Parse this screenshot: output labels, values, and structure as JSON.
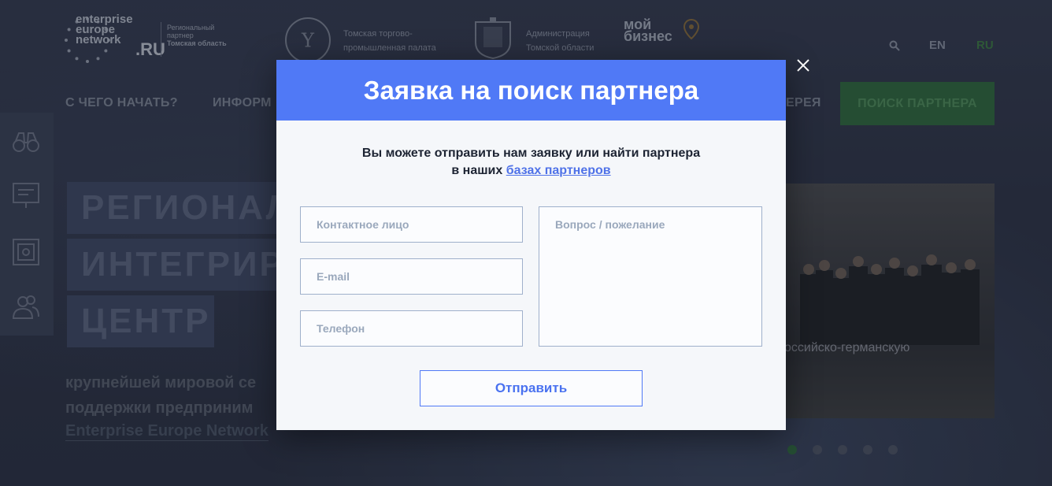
{
  "header": {
    "een_logo": {
      "brand": "enterprise europe network",
      "ru": ".RU",
      "partner_line1": "Региональный",
      "partner_line2": "партнер",
      "partner_line3": "Томская область"
    },
    "ttp_logo": {
      "text": "Томская торгово-промышленная палата"
    },
    "adm_logo": {
      "text": "Администрация Томской области"
    },
    "mb_logo": {
      "text1": "мой",
      "text2": "бизнес"
    },
    "search_icon": "search-icon",
    "lang_en": "EN",
    "lang_ru": "RU"
  },
  "nav": {
    "items": [
      "С ЧЕГО НАЧАТЬ?",
      "ИНФОРМ",
      "ЕРЕЯ"
    ],
    "cta": "ПОИСК ПАРТНЕРА"
  },
  "sidebar": {
    "icons": [
      "binoculars-icon",
      "presentation-icon",
      "safe-icon",
      "users-icon"
    ]
  },
  "hero": {
    "lines": [
      "РЕГИОНАЛ",
      "ИНТЕГРИР",
      "ЦЕНТР"
    ],
    "sub_line1": "крупнейшей мировой се",
    "sub_line2": "поддержки предприним",
    "link": "Enterprise Europe Network",
    "photo_caption": "оссийско-германскую",
    "slide_count": 5,
    "active_slide": 1
  },
  "modal": {
    "title": "Заявка на поиск партнера",
    "intro_line1": "Вы можете отправить нам заявку или найти партнера",
    "intro_prefix": "в наших ",
    "intro_link": "базах партнеров",
    "contact_placeholder": "Контактное лицо",
    "email_placeholder": "E-mail",
    "phone_placeholder": "Телефон",
    "question_placeholder": "Вопрос / пожелание",
    "submit_label": "Отправить",
    "close_icon": "close-icon"
  },
  "colors": {
    "accent": "#5079f6",
    "green": "#2f6b3c",
    "background": "#2c3345"
  }
}
